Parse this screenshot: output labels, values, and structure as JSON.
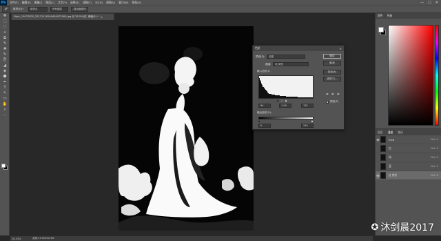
{
  "app": {
    "logo": "Ps"
  },
  "menubar": {
    "items": [
      "文件(F)",
      "编辑(E)",
      "图像(I)",
      "图层(L)",
      "文字(Y)",
      "选择(S)",
      "滤镜(T)",
      "3D(D)",
      "视图(V)",
      "窗口(W)",
      "帮助(H)"
    ],
    "window_controls": [
      "—",
      "□",
      "✕"
    ]
  },
  "options_bar": {
    "tool_glyph": "✐",
    "sample_size_label": "取样大小：",
    "sample_size_value": "取样点",
    "sample_layer_value": "所有图层",
    "show_ring_label": "显示取样环"
  },
  "document": {
    "tab_title": "Nipic_15037825_20121118190434972000.jpg @ 28.5%(红, 阈值/8) *",
    "close_glyph": "×",
    "zoom": "28.53%",
    "status_text": "文档:13.2M/22.9M"
  },
  "toolbar": {
    "tools": [
      "✥",
      "⬚",
      "◌",
      "⌖",
      "⧉",
      "✎",
      "✚",
      "✎",
      "⎘",
      "◢",
      "◈",
      "⬣",
      "✒",
      "T",
      "↖",
      "▭",
      "✋",
      "⌕",
      "⋯"
    ]
  },
  "color_panel": {
    "tabs": [
      "颜色",
      "色板"
    ],
    "fg_color": "#ffffff",
    "bg_color": "#000000"
  },
  "channels_panel": {
    "tabs": [
      "图层",
      "通道",
      "路径"
    ],
    "active_tab": "通道",
    "rows": [
      {
        "name": "RGB",
        "shortcut": "Ctrl+2",
        "visible": "👁",
        "selected": false
      },
      {
        "name": "红",
        "shortcut": "Ctrl+3",
        "visible": "",
        "selected": false
      },
      {
        "name": "绿",
        "shortcut": "Ctrl+4",
        "visible": "",
        "selected": false
      },
      {
        "name": "蓝",
        "shortcut": "Ctrl+5",
        "visible": "",
        "selected": false
      },
      {
        "name": "红 拷贝",
        "shortcut": "Ctrl+6",
        "visible": "👁",
        "selected": true
      }
    ]
  },
  "levels_dialog": {
    "title": "色阶",
    "close": "×",
    "preset_label": "预设(E):",
    "preset_value": "自定",
    "channel_label": "通道:",
    "channel_value": "红 拷贝",
    "input_levels_label": "输入色阶(I):",
    "input_black": "94",
    "input_gamma": "1.00",
    "input_white": "132",
    "output_levels_label": "输出色阶(O):",
    "output_black": "0",
    "output_white": "255",
    "buttons": {
      "ok": "确定",
      "cancel": "取消",
      "auto": "自动(A)",
      "options": "选项(T)..."
    },
    "preview_label": "预览(P)",
    "preview_check": "✓",
    "eyedroppers": [
      "✒",
      "✒",
      "✒"
    ]
  },
  "watermark": {
    "logo": "✪",
    "text": "沐剑晨2017"
  }
}
